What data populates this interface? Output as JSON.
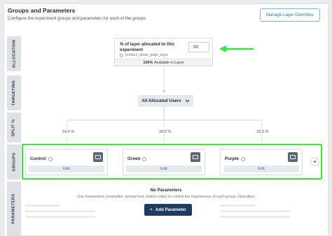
{
  "header": {
    "title": "Groups and Parameters",
    "subtitle": "Configure the experiment groups and parameters for each of the groups",
    "manage_button": "Manage Layer Overrides"
  },
  "sections": [
    "ALLOCATION",
    "TARGETING",
    "SPLIT %",
    "GROUPS",
    "PARAMETERS"
  ],
  "allocation": {
    "label": "% of layer allocated to this experiment",
    "layer_name": "product_detail_page_layer",
    "value": "50",
    "footer_bold": "100%",
    "footer_text": "Available in Layer"
  },
  "targeting": {
    "dropdown_label": "All Allocated Users"
  },
  "splits": [
    "33.4 %",
    "33.3 %",
    "33.3 %"
  ],
  "groups": [
    {
      "name": "Control",
      "edit": "Edit"
    },
    {
      "name": "Green",
      "edit": "Edit"
    },
    {
      "name": "Purple",
      "edit": "Edit"
    }
  ],
  "add_group_symbol": "+",
  "parameters": {
    "empty_title": "No Parameters",
    "empty_desc": "Use Parameters (examples: prompt text, button color) to control the experiences of each group. View",
    "docs_link": "docs",
    "add_button": "Add Parameter",
    "add_symbol": "+"
  },
  "colors": {
    "highlight": "#39e639",
    "primary": "#1f3a5f",
    "link": "#3d6fa3"
  }
}
